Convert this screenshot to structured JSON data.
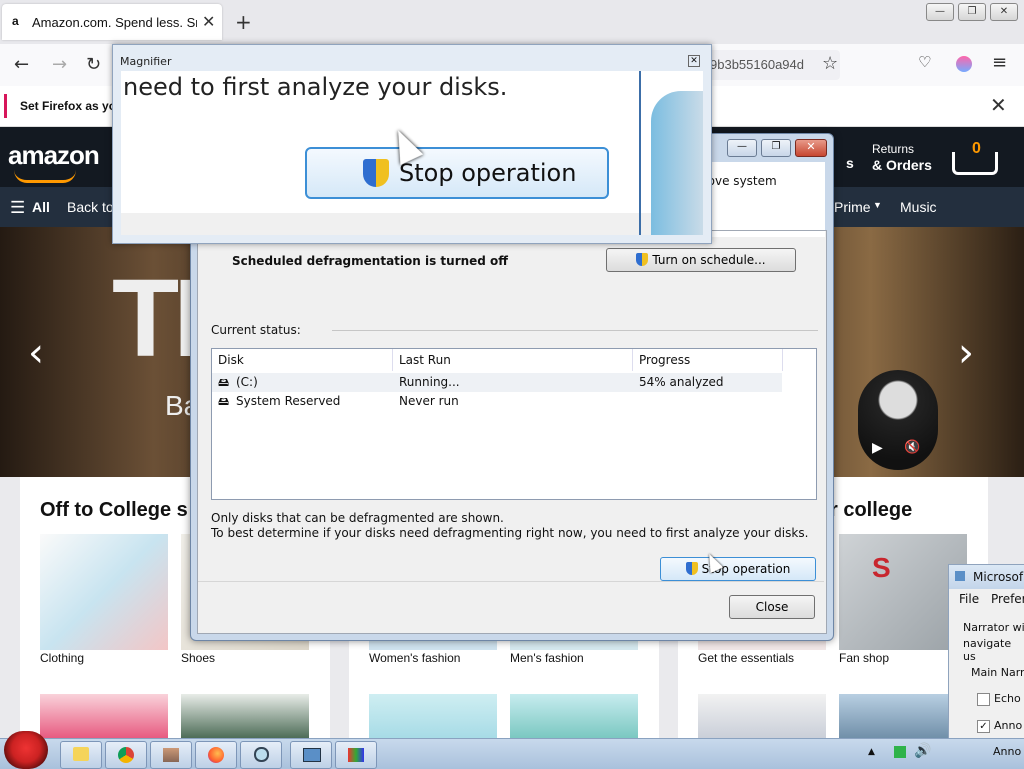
{
  "browser": {
    "tab_title": "Amazon.com. Spend less. Smile",
    "tab_favicon": "a",
    "tab_close": "✕",
    "new_tab": "+",
    "url_fragment": "9b3b55160a94d",
    "notification": "Set Firefox as yo",
    "notification_close": "✕",
    "window_controls": [
      "—",
      "❐",
      "✕"
    ],
    "nav_icons": [
      "back-icon",
      "forward-icon",
      "reload-icon",
      "bookmark-star-icon",
      "pocket-icon",
      "account-icon",
      "menu-icon"
    ]
  },
  "amazon": {
    "logo": "amazon",
    "returns_line1": "Returns",
    "returns_line2": "& Orders",
    "cart_count": "0",
    "header_fragment": "s",
    "nav_all": "All",
    "nav_back": "Back to",
    "nav_prime": "Prime",
    "nav_music": "Music",
    "hero_text_big": "TH",
    "hero_text_small": "Ba",
    "card_left_title": "Off to College s",
    "card_right_title": "r college",
    "tiles_left": [
      "Clothing",
      "Shoes"
    ],
    "tiles_mid": [
      "Women's fashion",
      "Men's fashion"
    ],
    "tiles_right": [
      "Get the essentials",
      "Fan shop"
    ]
  },
  "defrag": {
    "header_fragment": "rove system",
    "schedule_status": "Scheduled defragmentation is turned off",
    "schedule_button": "Turn on schedule...",
    "current_status_label": "Current status:",
    "columns": [
      "Disk",
      "Last Run",
      "Progress"
    ],
    "disks": [
      {
        "name": "(C:)",
        "last_run": "Running...",
        "progress": "54% analyzed"
      },
      {
        "name": "System Reserved",
        "last_run": "Never run",
        "progress": ""
      }
    ],
    "info_line1": "Only disks that can be defragmented are shown.",
    "info_line2": "To best determine if your disks need defragmenting right now, you need to first analyze your disks.",
    "stop_button": "Stop operation",
    "close_button": "Close"
  },
  "magnifier": {
    "title": "Magnifier",
    "zoom_text": "need to first analyze your disks.",
    "zoom_button": "Stop operation"
  },
  "narrator": {
    "title": "Microsof",
    "menu": [
      "File",
      "Prefere"
    ],
    "text_line1": "Narrator wi",
    "text_line2": "navigate us",
    "group_label": "Main Narr",
    "options": [
      {
        "label": "Echo",
        "checked": false
      },
      {
        "label": "Anno",
        "checked": true
      },
      {
        "label": "Anno",
        "checked": false
      }
    ]
  },
  "taskbar": {
    "apps": [
      "explorer-icon",
      "chrome-icon",
      "defrag-icon",
      "firefox-icon",
      "magnifier-icon",
      "narrator-icon",
      "paint-icon"
    ]
  },
  "colors": {
    "amazon_dark": "#131921",
    "amazon_nav": "#232f3e",
    "amazon_orange": "#ff9900",
    "firefox_notice": "#d7165a",
    "taskbar": "#b5cbe3"
  }
}
